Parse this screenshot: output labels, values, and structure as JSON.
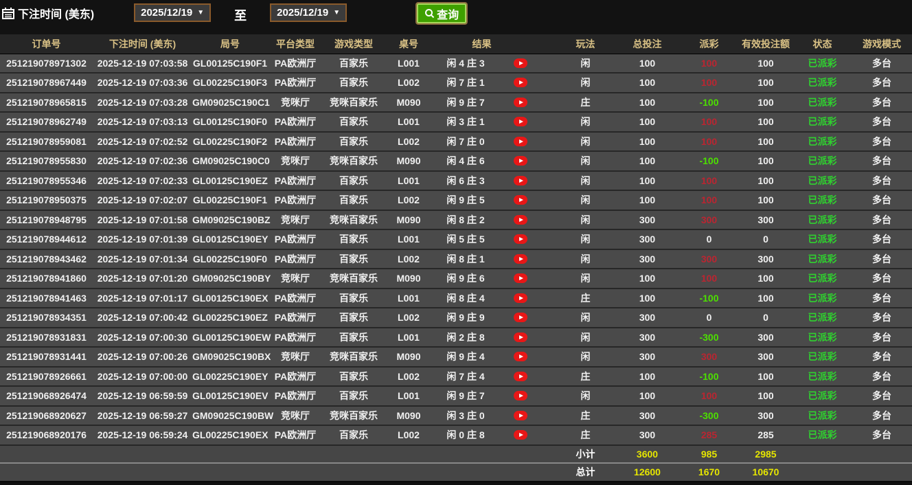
{
  "filter_bar": {
    "label": "下注时间 (美东)",
    "date_from": "2025/12/19",
    "between_label": "至",
    "date_to": "2025/12/19",
    "query_button": "查询",
    "calendar_icon": "calendar-icon",
    "search_icon": "search-icon",
    "caret_icon": "chevron-down-icon"
  },
  "table": {
    "columns": [
      {
        "key": "order_id",
        "label": "订单号"
      },
      {
        "key": "bet_time",
        "label": "下注时间 (美东)"
      },
      {
        "key": "round_id",
        "label": "局号"
      },
      {
        "key": "platform",
        "label": "平台类型"
      },
      {
        "key": "game_type",
        "label": "游戏类型"
      },
      {
        "key": "table_no",
        "label": "桌号"
      },
      {
        "key": "result",
        "label": "结果"
      },
      {
        "key": "bet_side",
        "label": "玩法"
      },
      {
        "key": "total_bet",
        "label": "总投注"
      },
      {
        "key": "payout",
        "label": "派彩"
      },
      {
        "key": "valid_bet",
        "label": "有效投注额"
      },
      {
        "key": "status",
        "label": "状态"
      },
      {
        "key": "game_mode",
        "label": "游戏模式"
      }
    ],
    "replay_icon": "play-icon",
    "rows": [
      {
        "order_id": "251219078971302",
        "bet_time": "2025-12-19 07:03:58",
        "round_id": "GL00125C190F1",
        "platform": "PA欧洲厅",
        "game_type": "百家乐",
        "table_no": "L001",
        "result": "闲 4 庄 3",
        "bet_side": "闲",
        "total_bet": 100,
        "payout": 100,
        "valid_bet": 100,
        "status": "已派彩",
        "game_mode": "多台"
      },
      {
        "order_id": "251219078967449",
        "bet_time": "2025-12-19 07:03:36",
        "round_id": "GL00225C190F3",
        "platform": "PA欧洲厅",
        "game_type": "百家乐",
        "table_no": "L002",
        "result": "闲 7 庄 1",
        "bet_side": "闲",
        "total_bet": 100,
        "payout": 100,
        "valid_bet": 100,
        "status": "已派彩",
        "game_mode": "多台"
      },
      {
        "order_id": "251219078965815",
        "bet_time": "2025-12-19 07:03:28",
        "round_id": "GM09025C190C1",
        "platform": "竞咪厅",
        "game_type": "竞咪百家乐",
        "table_no": "M090",
        "result": "闲 9 庄 7",
        "bet_side": "庄",
        "total_bet": 100,
        "payout": -100,
        "valid_bet": 100,
        "status": "已派彩",
        "game_mode": "多台"
      },
      {
        "order_id": "251219078962749",
        "bet_time": "2025-12-19 07:03:13",
        "round_id": "GL00125C190F0",
        "platform": "PA欧洲厅",
        "game_type": "百家乐",
        "table_no": "L001",
        "result": "闲 3 庄 1",
        "bet_side": "闲",
        "total_bet": 100,
        "payout": 100,
        "valid_bet": 100,
        "status": "已派彩",
        "game_mode": "多台"
      },
      {
        "order_id": "251219078959081",
        "bet_time": "2025-12-19 07:02:52",
        "round_id": "GL00225C190F2",
        "platform": "PA欧洲厅",
        "game_type": "百家乐",
        "table_no": "L002",
        "result": "闲 7 庄 0",
        "bet_side": "闲",
        "total_bet": 100,
        "payout": 100,
        "valid_bet": 100,
        "status": "已派彩",
        "game_mode": "多台"
      },
      {
        "order_id": "251219078955830",
        "bet_time": "2025-12-19 07:02:36",
        "round_id": "GM09025C190C0",
        "platform": "竞咪厅",
        "game_type": "竞咪百家乐",
        "table_no": "M090",
        "result": "闲 4 庄 6",
        "bet_side": "闲",
        "total_bet": 100,
        "payout": -100,
        "valid_bet": 100,
        "status": "已派彩",
        "game_mode": "多台"
      },
      {
        "order_id": "251219078955346",
        "bet_time": "2025-12-19 07:02:33",
        "round_id": "GL00125C190EZ",
        "platform": "PA欧洲厅",
        "game_type": "百家乐",
        "table_no": "L001",
        "result": "闲 6 庄 3",
        "bet_side": "闲",
        "total_bet": 100,
        "payout": 100,
        "valid_bet": 100,
        "status": "已派彩",
        "game_mode": "多台"
      },
      {
        "order_id": "251219078950375",
        "bet_time": "2025-12-19 07:02:07",
        "round_id": "GL00225C190F1",
        "platform": "PA欧洲厅",
        "game_type": "百家乐",
        "table_no": "L002",
        "result": "闲 9 庄 5",
        "bet_side": "闲",
        "total_bet": 100,
        "payout": 100,
        "valid_bet": 100,
        "status": "已派彩",
        "game_mode": "多台"
      },
      {
        "order_id": "251219078948795",
        "bet_time": "2025-12-19 07:01:58",
        "round_id": "GM09025C190BZ",
        "platform": "竞咪厅",
        "game_type": "竞咪百家乐",
        "table_no": "M090",
        "result": "闲 8 庄 2",
        "bet_side": "闲",
        "total_bet": 300,
        "payout": 300,
        "valid_bet": 300,
        "status": "已派彩",
        "game_mode": "多台"
      },
      {
        "order_id": "251219078944612",
        "bet_time": "2025-12-19 07:01:39",
        "round_id": "GL00125C190EY",
        "platform": "PA欧洲厅",
        "game_type": "百家乐",
        "table_no": "L001",
        "result": "闲 5 庄 5",
        "bet_side": "闲",
        "total_bet": 300,
        "payout": 0,
        "valid_bet": 0,
        "status": "已派彩",
        "game_mode": "多台"
      },
      {
        "order_id": "251219078943462",
        "bet_time": "2025-12-19 07:01:34",
        "round_id": "GL00225C190F0",
        "platform": "PA欧洲厅",
        "game_type": "百家乐",
        "table_no": "L002",
        "result": "闲 8 庄 1",
        "bet_side": "闲",
        "total_bet": 300,
        "payout": 300,
        "valid_bet": 300,
        "status": "已派彩",
        "game_mode": "多台"
      },
      {
        "order_id": "251219078941860",
        "bet_time": "2025-12-19 07:01:20",
        "round_id": "GM09025C190BY",
        "platform": "竞咪厅",
        "game_type": "竞咪百家乐",
        "table_no": "M090",
        "result": "闲 9 庄 6",
        "bet_side": "闲",
        "total_bet": 100,
        "payout": 100,
        "valid_bet": 100,
        "status": "已派彩",
        "game_mode": "多台"
      },
      {
        "order_id": "251219078941463",
        "bet_time": "2025-12-19 07:01:17",
        "round_id": "GL00125C190EX",
        "platform": "PA欧洲厅",
        "game_type": "百家乐",
        "table_no": "L001",
        "result": "闲 8 庄 4",
        "bet_side": "庄",
        "total_bet": 100,
        "payout": -100,
        "valid_bet": 100,
        "status": "已派彩",
        "game_mode": "多台"
      },
      {
        "order_id": "251219078934351",
        "bet_time": "2025-12-19 07:00:42",
        "round_id": "GL00225C190EZ",
        "platform": "PA欧洲厅",
        "game_type": "百家乐",
        "table_no": "L002",
        "result": "闲 9 庄 9",
        "bet_side": "闲",
        "total_bet": 300,
        "payout": 0,
        "valid_bet": 0,
        "status": "已派彩",
        "game_mode": "多台"
      },
      {
        "order_id": "251219078931831",
        "bet_time": "2025-12-19 07:00:30",
        "round_id": "GL00125C190EW",
        "platform": "PA欧洲厅",
        "game_type": "百家乐",
        "table_no": "L001",
        "result": "闲 2 庄 8",
        "bet_side": "闲",
        "total_bet": 300,
        "payout": -300,
        "valid_bet": 300,
        "status": "已派彩",
        "game_mode": "多台"
      },
      {
        "order_id": "251219078931441",
        "bet_time": "2025-12-19 07:00:26",
        "round_id": "GM09025C190BX",
        "platform": "竞咪厅",
        "game_type": "竞咪百家乐",
        "table_no": "M090",
        "result": "闲 9 庄 4",
        "bet_side": "闲",
        "total_bet": 300,
        "payout": 300,
        "valid_bet": 300,
        "status": "已派彩",
        "game_mode": "多台"
      },
      {
        "order_id": "251219078926661",
        "bet_time": "2025-12-19 07:00:00",
        "round_id": "GL00225C190EY",
        "platform": "PA欧洲厅",
        "game_type": "百家乐",
        "table_no": "L002",
        "result": "闲 7 庄 4",
        "bet_side": "庄",
        "total_bet": 100,
        "payout": -100,
        "valid_bet": 100,
        "status": "已派彩",
        "game_mode": "多台"
      },
      {
        "order_id": "251219068926474",
        "bet_time": "2025-12-19 06:59:59",
        "round_id": "GL00125C190EV",
        "platform": "PA欧洲厅",
        "game_type": "百家乐",
        "table_no": "L001",
        "result": "闲 9 庄 7",
        "bet_side": "闲",
        "total_bet": 100,
        "payout": 100,
        "valid_bet": 100,
        "status": "已派彩",
        "game_mode": "多台"
      },
      {
        "order_id": "251219068920627",
        "bet_time": "2025-12-19 06:59:27",
        "round_id": "GM09025C190BW",
        "platform": "竞咪厅",
        "game_type": "竞咪百家乐",
        "table_no": "M090",
        "result": "闲 3 庄 0",
        "bet_side": "庄",
        "total_bet": 300,
        "payout": -300,
        "valid_bet": 300,
        "status": "已派彩",
        "game_mode": "多台"
      },
      {
        "order_id": "251219068920176",
        "bet_time": "2025-12-19 06:59:24",
        "round_id": "GL00225C190EX",
        "platform": "PA欧洲厅",
        "game_type": "百家乐",
        "table_no": "L002",
        "result": "闲 0 庄 8",
        "bet_side": "庄",
        "total_bet": 300,
        "payout": 285,
        "valid_bet": 285,
        "status": "已派彩",
        "game_mode": "多台"
      }
    ],
    "subtotal": {
      "label": "小计",
      "total_bet": "3600",
      "payout": "985",
      "valid_bet": "2985"
    },
    "total": {
      "label": "总计",
      "total_bet": "12600",
      "payout": "1670",
      "valid_bet": "10670"
    }
  },
  "colors": {
    "payout_positive": "#bb2531",
    "payout_negative": "#4ce000",
    "status_paid": "#2fd22f",
    "summary_value": "#e6e600",
    "header_text": "#d9c185",
    "row_bg": "#4a4a4a",
    "query_button_bg": "#3fa000",
    "date_select_border": "#8a5a2b",
    "replay_icon_bg": "#e81717"
  }
}
